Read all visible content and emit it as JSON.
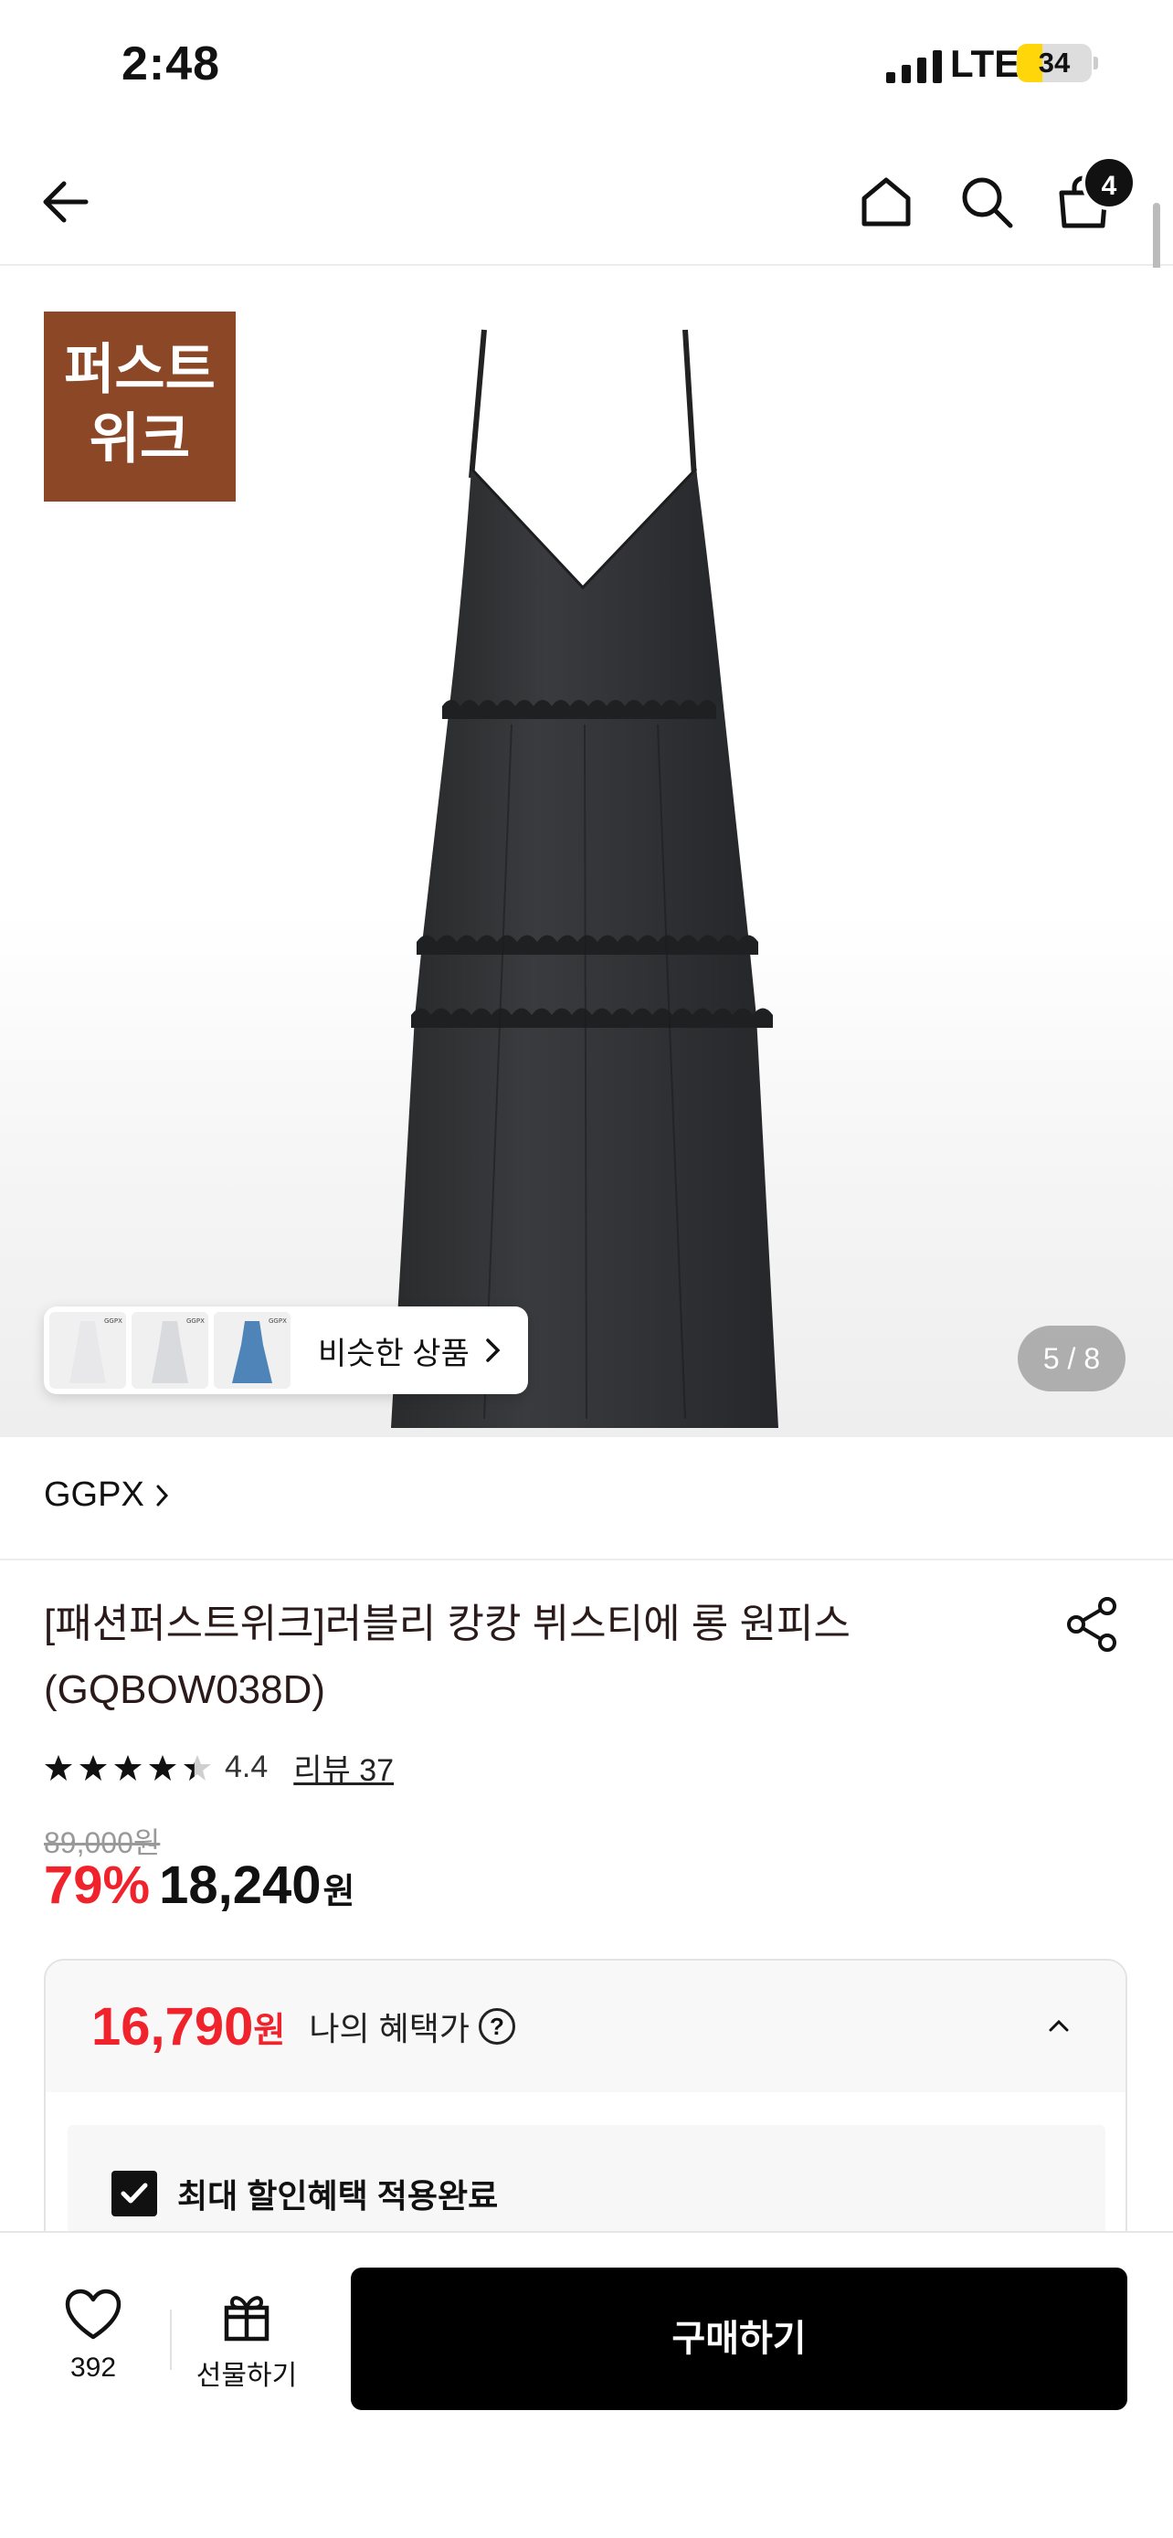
{
  "status_bar": {
    "time": "2:48",
    "network": "LTE",
    "battery": "34",
    "battery_level": 0.34
  },
  "header": {
    "cart_count": "4"
  },
  "gallery": {
    "badge_line1": "퍼스트",
    "badge_line2": "위크",
    "similar_label": "비슷한 상품",
    "thumb_brand": "GGPX",
    "pager": "5 / 8"
  },
  "product": {
    "brand": "GGPX",
    "title": "[패션퍼스트위크]러블리 캉캉 뷔스티에 롱 원피스 (GQBOW038D)",
    "rating": 4.4,
    "rating_text": "4.4",
    "reviews": "리뷰 37",
    "original_price": "89,000원",
    "discount": "79%",
    "price": "18,240",
    "currency": "원"
  },
  "benefit": {
    "price": "16,790",
    "currency": "원",
    "label": "나의 혜택가",
    "help_icon": "?",
    "applied_label": "최대 할인혜택 적용완료"
  },
  "bottom_bar": {
    "like_count": "392",
    "gift_label": "선물하기",
    "buy_label": "구매하기"
  },
  "colors": {
    "accent_red": "#f0232d",
    "badge_brown": "#8b4726",
    "black": "#000000"
  }
}
